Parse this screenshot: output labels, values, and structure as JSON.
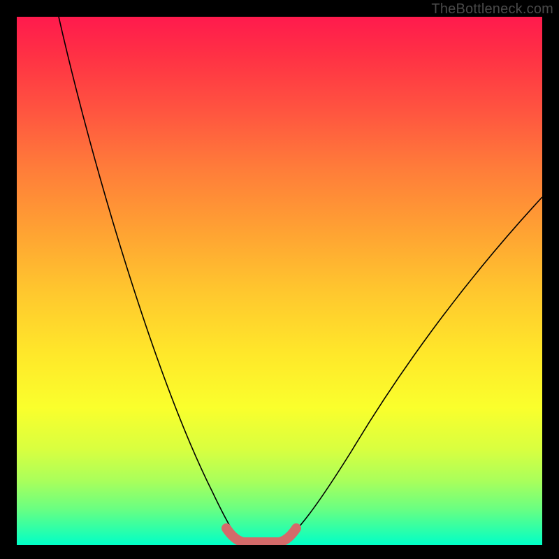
{
  "watermark": "TheBottleneck.com",
  "chart_data": {
    "type": "line",
    "title": "",
    "xlabel": "",
    "ylabel": "",
    "xlim": [
      0,
      100
    ],
    "ylim": [
      0,
      100
    ],
    "grid": false,
    "legend": false,
    "series": [
      {
        "name": "left-curve",
        "x": [
          8,
          12,
          16,
          20,
          24,
          28,
          32,
          36,
          40,
          42
        ],
        "y": [
          100,
          88,
          75,
          63,
          50,
          38,
          25,
          13,
          3,
          0
        ],
        "color": "#000000",
        "weight": 1.5
      },
      {
        "name": "right-curve",
        "x": [
          50,
          54,
          58,
          62,
          68,
          74,
          80,
          86,
          92,
          98
        ],
        "y": [
          0,
          3,
          8,
          14,
          23,
          33,
          42,
          51,
          59,
          66
        ],
        "color": "#000000",
        "weight": 1.5
      },
      {
        "name": "bottom-highlight",
        "x": [
          40,
          42,
          44,
          46,
          48,
          50,
          52
        ],
        "y": [
          2.5,
          0.5,
          0,
          0,
          0,
          0.5,
          2.5
        ],
        "color": "#d46a6a",
        "weight": 10
      }
    ],
    "notes": "No axis ticks or numeric labels are visible; x and y values are estimated in percent of plot width/height. The vertical gradient encodes a qualitative good(bottom)→bad(top) scale."
  }
}
